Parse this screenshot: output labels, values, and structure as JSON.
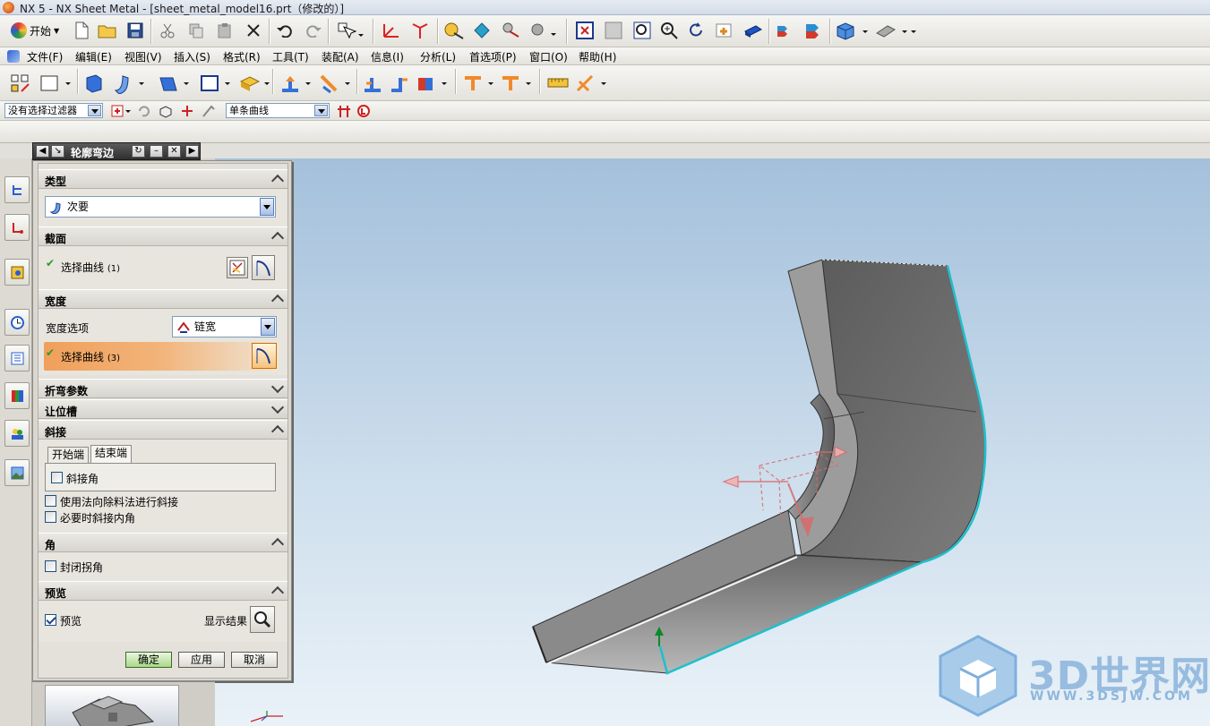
{
  "window": {
    "title": "NX 5 - NX Sheet Metal - [sheet_metal_model16.prt（修改的）]"
  },
  "toolbar": {
    "start_label": "开始"
  },
  "menu": {
    "items": [
      "文件(F)",
      "编辑(E)",
      "视图(V)",
      "插入(S)",
      "格式(R)",
      "工具(T)",
      "装配(A)",
      "信息(I)",
      "分析(L)",
      "首选项(P)",
      "窗口(O)",
      "帮助(H)"
    ]
  },
  "selection_bar": {
    "filter": "没有选择过滤器",
    "curve_rule": "单条曲线"
  },
  "dialog": {
    "title": "轮廓弯边",
    "type": {
      "header": "类型",
      "value": "次要"
    },
    "section": {
      "header": "截面",
      "select_label": "选择曲线",
      "select_count": "(1)"
    },
    "width": {
      "header": "宽度",
      "option_label": "宽度选项",
      "option_value": "链宽",
      "select_label": "选择曲线",
      "select_count": "(3)"
    },
    "bend_params": {
      "header": "折弯参数"
    },
    "relief": {
      "header": "让位槽"
    },
    "miter": {
      "header": "斜接",
      "tabs": [
        "开始端",
        "结束端"
      ],
      "miter_angle": "斜接角",
      "use_normal": "使用法向除料法进行斜接",
      "inner_corner": "必要时斜接内角"
    },
    "corner": {
      "header": "角",
      "closed_corner": "封闭拐角"
    },
    "preview": {
      "header": "预览",
      "preview_label": "预览",
      "show_result": "显示结果"
    },
    "buttons": {
      "ok": "确定",
      "apply": "应用",
      "cancel": "取消"
    }
  },
  "watermark": {
    "brand": "3D世界网",
    "url": "WWW.3DSJW.COM"
  },
  "colors": {
    "accent_orange": "#f0a05a",
    "edge_highlight": "#1fb8c8",
    "part_gray": "#6f6f6f",
    "viewport_top": "#a4c0db"
  },
  "icons": [
    "new-icon",
    "open-icon",
    "save-icon",
    "cut-icon",
    "copy-icon",
    "paste-icon",
    "delete-icon",
    "undo-icon",
    "redo-icon",
    "select-icon",
    "fit-icon",
    "zoom-icon",
    "rotate-icon",
    "pan-icon",
    "shaded-icon",
    "sketch-icon",
    "flange-icon",
    "contour-flange-icon",
    "bend-icon",
    "unbend-icon",
    "measure-icon"
  ]
}
